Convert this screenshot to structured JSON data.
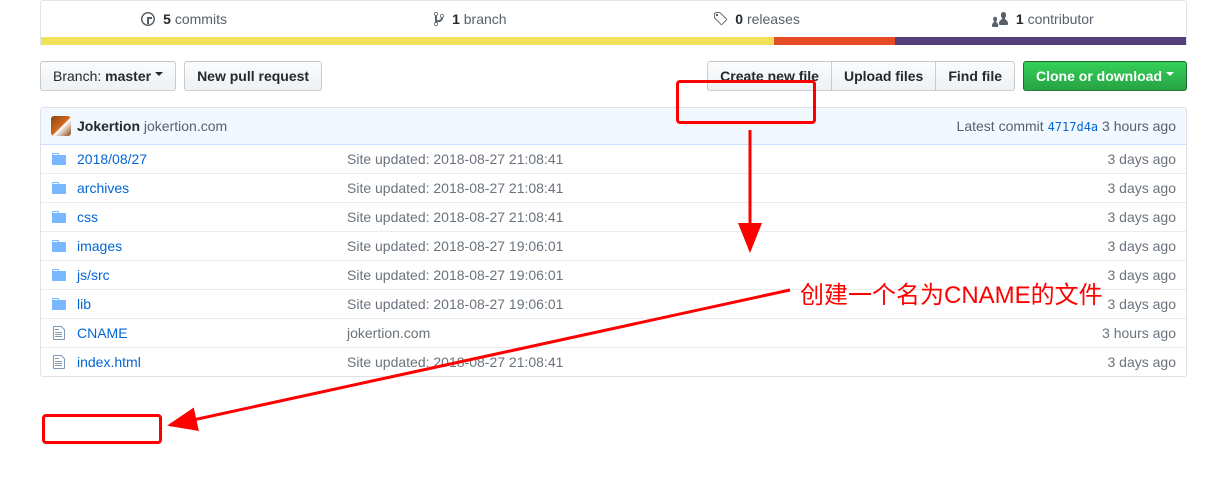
{
  "stats": {
    "commits": {
      "count": "5",
      "label": "commits"
    },
    "branches": {
      "count": "1",
      "label": "branch"
    },
    "releases": {
      "count": "0",
      "label": "releases"
    },
    "contributors": {
      "count": "1",
      "label": "contributor"
    }
  },
  "toolbar": {
    "branch_prefix": "Branch:",
    "branch_name": "master",
    "new_pr": "New pull request",
    "create_file": "Create new file",
    "upload_files": "Upload files",
    "find_file": "Find file",
    "clone": "Clone or download"
  },
  "commit_tease": {
    "author": "Jokertion",
    "message": "jokertion.com",
    "latest_prefix": "Latest commit",
    "sha": "4717d4a",
    "age": "3 hours ago"
  },
  "files": [
    {
      "type": "dir",
      "name_html": "2018/08/<a>27</a>",
      "msg": "Site updated: 2018-08-27 21:08:41",
      "age": "3 days ago"
    },
    {
      "type": "dir",
      "name_html": "<a>archives</a>",
      "msg": "Site updated: 2018-08-27 21:08:41",
      "age": "3 days ago"
    },
    {
      "type": "dir",
      "name_html": "<a>css</a>",
      "msg": "Site updated: 2018-08-27 21:08:41",
      "age": "3 days ago"
    },
    {
      "type": "dir",
      "name_html": "<a>images</a>",
      "msg": "Site updated: 2018-08-27 19:06:01",
      "age": "3 days ago"
    },
    {
      "type": "dir",
      "name_html": "js/<a>src</a>",
      "msg": "Site updated: 2018-08-27 19:06:01",
      "age": "3 days ago"
    },
    {
      "type": "dir",
      "name_html": "<a>lib</a>",
      "msg": "Site updated: 2018-08-27 19:06:01",
      "age": "3 days ago"
    },
    {
      "type": "file",
      "name_html": "<a>CNAME</a>",
      "msg": "jokertion.com",
      "age": "3 hours ago"
    },
    {
      "type": "file",
      "name_html": "<a>index.html</a>",
      "msg": "Site updated: 2018-08-27 21:08:41",
      "age": "3 days ago"
    }
  ],
  "annotation": {
    "text": "创建一个名为CNAME的文件"
  }
}
